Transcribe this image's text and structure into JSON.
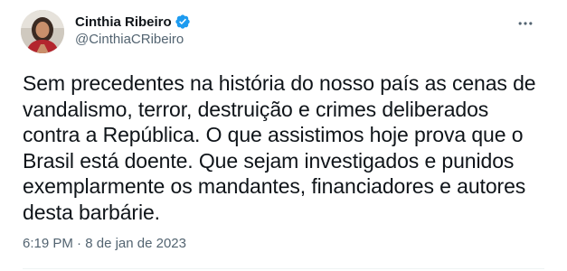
{
  "author": {
    "display_name": "Cinthia Ribeiro",
    "handle": "@CinthiaCRibeiro",
    "verified": true,
    "avatar_icon": "profile-photo"
  },
  "tweet": {
    "text": "Sem precedentes na história do nosso país as cenas de vandalismo, terror, destruição e crimes deliberados contra a República. O que assistimos hoje prova que o Brasil está doente. Que sejam investigados e punidos exemplarmente os mandantes, financiadores e autores desta barbárie."
  },
  "meta": {
    "time": "6:19 PM",
    "separator": "·",
    "date": "8 de jan de 2023"
  },
  "colors": {
    "verified": "#1d9bf0",
    "secondary_text": "#536471",
    "primary_text": "#0f1419"
  },
  "icons": {
    "more": "more-horizontal-icon",
    "verified": "verified-badge-icon"
  }
}
